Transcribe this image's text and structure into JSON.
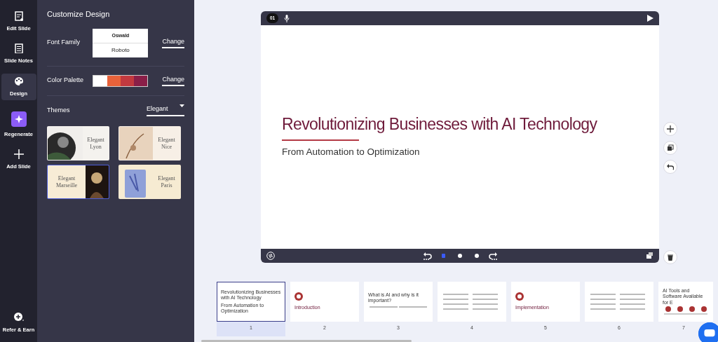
{
  "nav_rail": {
    "items": [
      {
        "label": "Edit Slide",
        "selected": false
      },
      {
        "label": "Slide Notes",
        "selected": false
      },
      {
        "label": "Design",
        "selected": true
      },
      {
        "label": "Regenerate",
        "selected": false
      },
      {
        "label": "Add Slide",
        "selected": false
      }
    ],
    "footer": {
      "label": "Refer & Earn"
    }
  },
  "design_panel": {
    "title": "Customize Design",
    "font_family": {
      "label": "Font Family",
      "fonts": [
        "Oswald",
        "Roboto"
      ],
      "action": "Change"
    },
    "color_palette": {
      "label": "Color Palette",
      "swatches": [
        {
          "color": "#ffffff"
        },
        {
          "color": "#e8623a"
        },
        {
          "color": "#c2393f"
        },
        {
          "color": "#8a1f48"
        }
      ],
      "action": "Change"
    },
    "themes": {
      "label": "Themes",
      "dropdown": "Elegant",
      "items": [
        {
          "name": "Elegant\nLyon",
          "selected": false
        },
        {
          "name": "Elegant\nNice",
          "selected": false
        },
        {
          "name": "Elegant\nMarseille",
          "selected": true
        },
        {
          "name": "Elegant\nParis",
          "selected": false
        }
      ]
    }
  },
  "slide": {
    "number": "01",
    "title": "Revolutionizing Businesses with AI Technology",
    "subtitle": "From Automation to Optimization",
    "dots": [
      {
        "selected": true
      },
      {
        "selected": false
      },
      {
        "selected": false
      }
    ]
  },
  "thumbnails": [
    {
      "kind": "title",
      "title": "Revolutionizing Businesses with AI Technology",
      "subtitle": "From Automation to Optimization",
      "number": "1",
      "selected": true
    },
    {
      "kind": "section",
      "title": "Introduction",
      "number": "2",
      "selected": false
    },
    {
      "kind": "heading",
      "title": "What is AI and why is it important?",
      "number": "3",
      "selected": false
    },
    {
      "kind": "text",
      "number": "4",
      "selected": false
    },
    {
      "kind": "section",
      "title": "Implementation",
      "number": "5",
      "selected": false
    },
    {
      "kind": "text",
      "number": "6",
      "selected": false
    },
    {
      "kind": "cards",
      "title": "AI Tools and Software Available for E",
      "number": "7",
      "selected": false
    }
  ]
}
